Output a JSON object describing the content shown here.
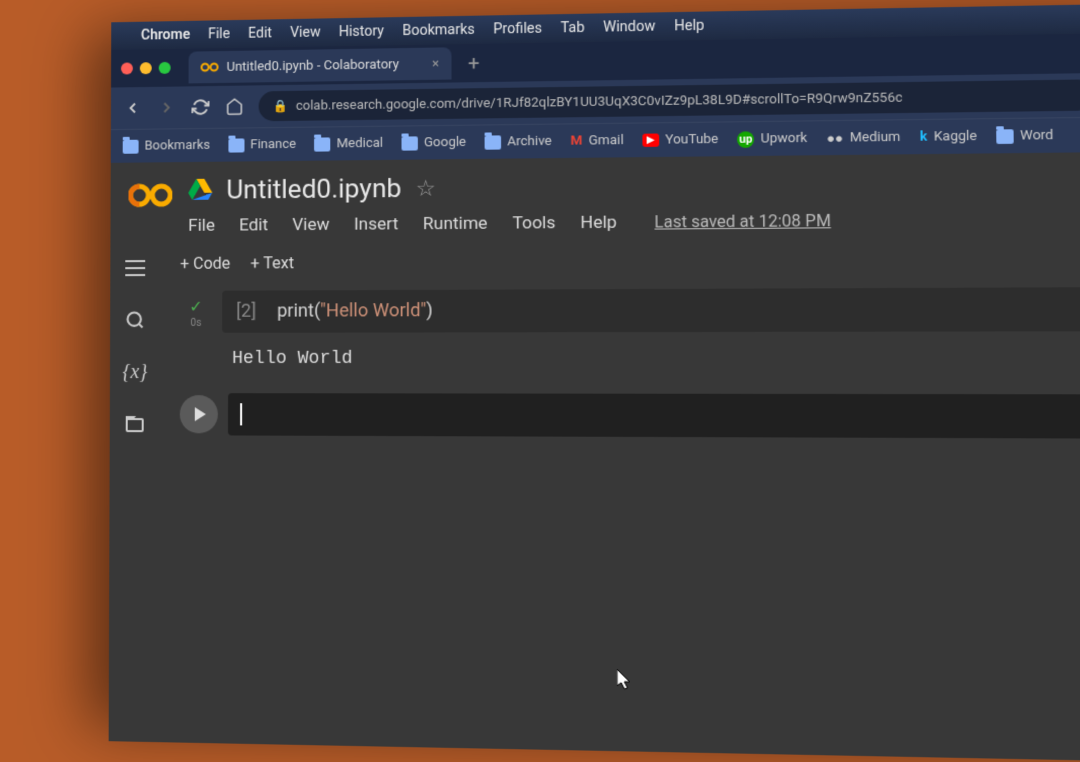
{
  "macos": {
    "app_name": "Chrome",
    "menus": [
      "File",
      "Edit",
      "View",
      "History",
      "Bookmarks",
      "Profiles",
      "Tab",
      "Window",
      "Help"
    ]
  },
  "chrome": {
    "tab_title": "Untitled0.ipynb - Colaboratory",
    "url": "colab.research.google.com/drive/1RJf82qlzBY1UU3UqX3C0vIZz9pL38L9D#scrollTo=R9Qrw9nZ556c",
    "bookmarks": [
      "Bookmarks",
      "Finance",
      "Medical",
      "Google",
      "Archive",
      "Gmail",
      "YouTube",
      "Upwork",
      "Medium",
      "Kaggle",
      "Word"
    ]
  },
  "colab": {
    "notebook_title": "Untitled0.ipynb",
    "menus": [
      "File",
      "Edit",
      "View",
      "Insert",
      "Runtime",
      "Tools",
      "Help"
    ],
    "last_saved": "Last saved at 12:08 PM",
    "add_code_label": "+ Code",
    "add_text_label": "+ Text",
    "cell": {
      "exec_count": "[2]",
      "exec_time": "0s",
      "code_fn": "print",
      "code_str": "\"Hello World\"",
      "output": "Hello World"
    }
  }
}
